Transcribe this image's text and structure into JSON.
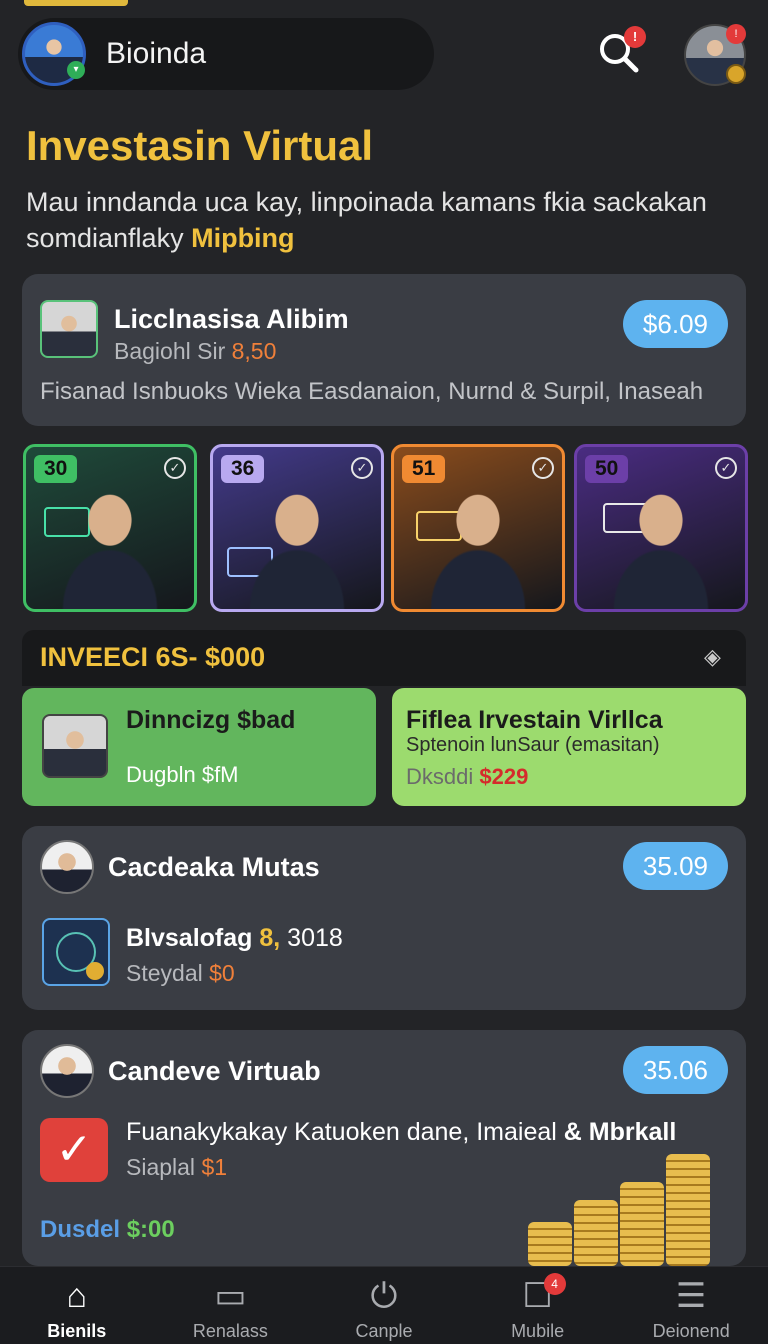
{
  "header": {
    "user_name": "Bioinda",
    "search_badge": "!",
    "profile_badge": "!"
  },
  "page": {
    "title": "Investasin Virtual",
    "subtitle_main": "Mau inndanda uca kay, linpoinada kamans fkia sackakan somdianflaky ",
    "subtitle_highlight": "Mipbing"
  },
  "featured_card": {
    "title": "Licclnasisa Alibim",
    "subtitle_prefix": "Bagiohl Sir ",
    "subtitle_amount": "8,50",
    "price": "$6.09",
    "description": "Fisanad Isnbuoks Wieka Easdanaion, Nurnd & Surpil, Inaseah"
  },
  "tiles": [
    {
      "number": "30",
      "accent": "#3fbf64",
      "bg": "#1f4a3a"
    },
    {
      "number": "36",
      "accent": "#b8a9f0",
      "bg": "#433a8a"
    },
    {
      "number": "51",
      "accent": "#f08a32",
      "bg": "#8a4c1c"
    },
    {
      "number": "50",
      "accent": "#6c3fa8",
      "bg": "#4a2c82"
    }
  ],
  "section": {
    "label": "INVEECI 6S- $000"
  },
  "green_cards": [
    {
      "title": "Dinncizg $bad",
      "value": "Dugbln $fM"
    },
    {
      "title": "Fiflea Irvestain Virllca",
      "subtitle": "Sptenoin lunSaur (emasitan)",
      "value_prefix": "Dksddi ",
      "value_amount": "$229"
    }
  ],
  "card_3": {
    "title": "Cacdeaka Mutas",
    "price": "35.09",
    "item_title_prefix": "Blvsalofag ",
    "item_title_amount": "8,",
    "item_title_suffix": " 3018",
    "item_sub_prefix": "Steydal ",
    "item_sub_amount": "$0"
  },
  "card_4": {
    "title": "Candeve Virtuab",
    "price": "35.06",
    "item_title_prefix": "Fuanakykakay Katuoken dane, Imaieal ",
    "item_title_bold": "& Mbrkall",
    "item_sub_prefix": "Siaplal ",
    "item_sub_amount": "$1",
    "footer_blue": "Dusdel ",
    "footer_green": "$:00"
  },
  "bottom_nav": [
    {
      "label": "Bienils",
      "icon": "home-icon"
    },
    {
      "label": "Renalass",
      "icon": "calendar-icon"
    },
    {
      "label": "Canple",
      "icon": "power-icon"
    },
    {
      "label": "Mubile",
      "icon": "mobile-icon",
      "badge": "4"
    },
    {
      "label": "Deionend",
      "icon": "menu-icon"
    }
  ],
  "colors": {
    "background": "#232427",
    "accent_gold": "#f0c13e",
    "price_pill": "#5eb3ef",
    "amount_orange": "#f0803a"
  }
}
